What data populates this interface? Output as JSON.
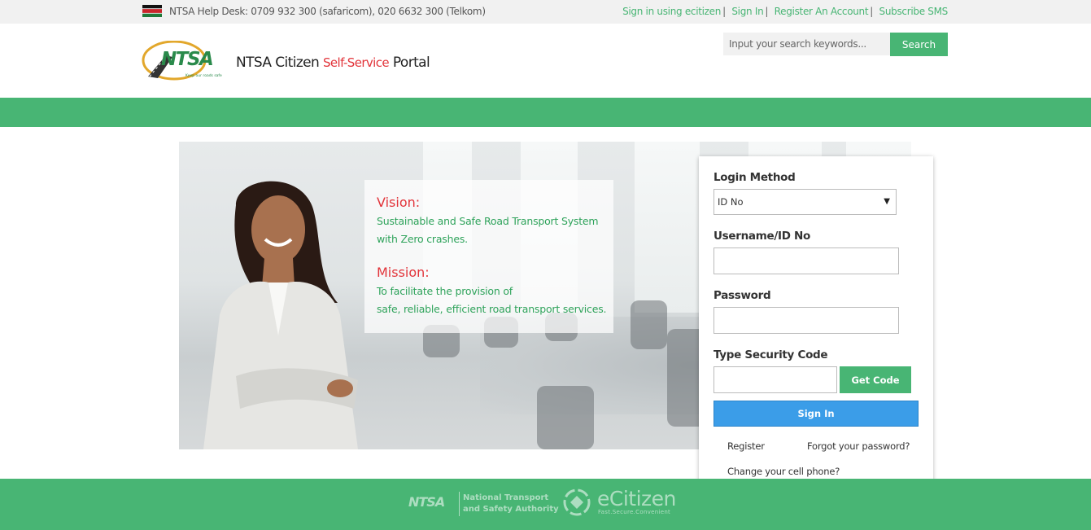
{
  "topbar": {
    "helpdesk": "NTSA Help Desk: 0709 932 300 (safaricom), 020 6632 300 (Telkom)",
    "links": [
      {
        "label": "Sign in using ecitizen"
      },
      {
        "label": "Sign In"
      },
      {
        "label": "Register An Account"
      },
      {
        "label": "Subscribe SMS"
      }
    ],
    "separator": "|"
  },
  "header": {
    "logo_mark": "NTSA",
    "logo_tagline": "Keep our roads safe",
    "portal_name_prefix": "NTSA Citizen",
    "portal_name_highlight": "Self-Service",
    "portal_name_suffix": "Portal",
    "search_placeholder": "Input your search keywords...",
    "search_button": "Search"
  },
  "hero": {
    "vision_title": "Vision:",
    "vision_line1": "Sustainable and Safe Road Transport System",
    "vision_line2": "with Zero crashes.",
    "mission_title": "Mission:",
    "mission_line1": "To facilitate the provision of",
    "mission_line2": "safe, reliable, efficient road transport services."
  },
  "login": {
    "method_label": "Login Method",
    "method_value": "ID No",
    "username_label": "Username/ID No",
    "password_label": "Password",
    "security_label": "Type Security Code",
    "get_code_button": "Get Code",
    "signin_button": "Sign In",
    "register_link": "Register",
    "forgot_link": "Forgot your password?",
    "change_phone_link": "Change your cell phone?"
  },
  "footer": {
    "ntsa_mark": "NTSA",
    "ntsa_name_line1": "National Transport",
    "ntsa_name_line2": "and Safety Authority",
    "ecitizen_name": "eCitizen",
    "ecitizen_tagline": "Fast.Secure.Convenient"
  },
  "colors": {
    "brand_green": "#48b574",
    "accent_red": "#e2343a",
    "signin_blue": "#3b9de8"
  }
}
